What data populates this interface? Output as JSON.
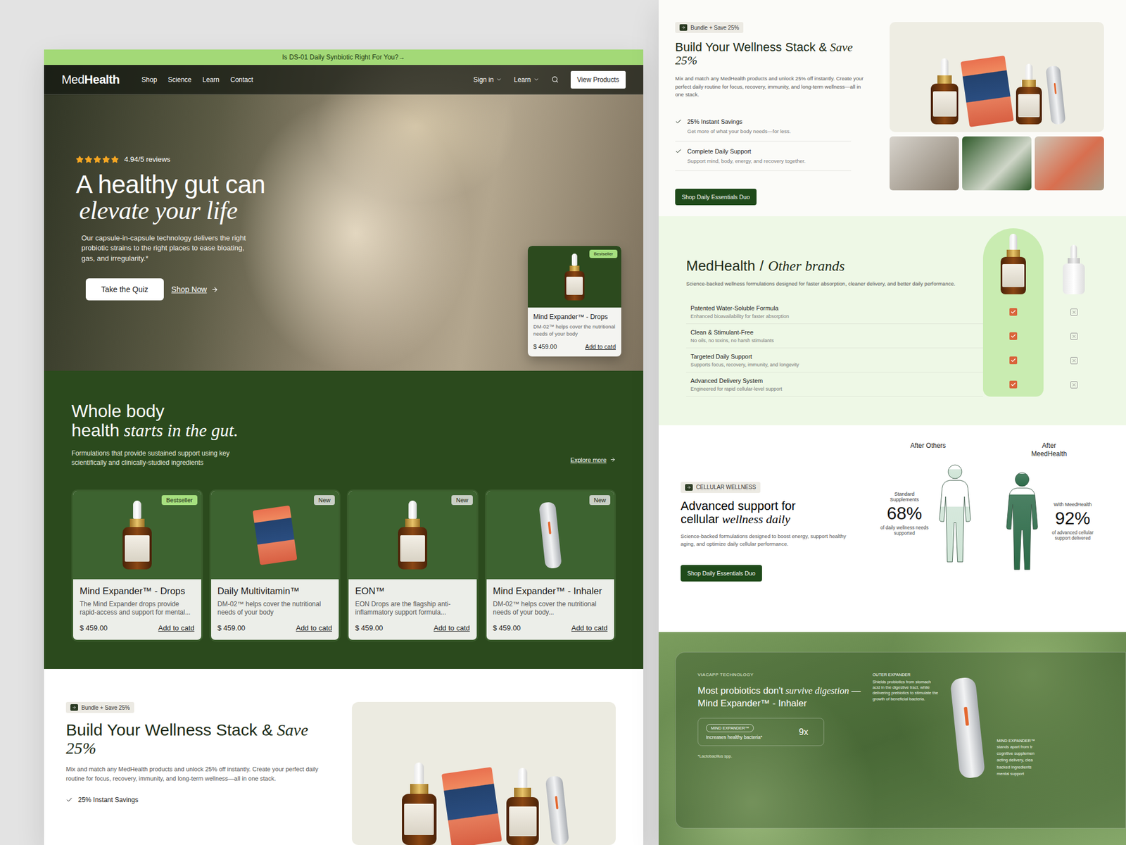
{
  "promo_bar": {
    "text": "Is DS-01 Daily Synbiotic Right For You?→"
  },
  "nav": {
    "logo_light": "Med",
    "logo_bold": "Health",
    "links": [
      "Shop",
      "Science",
      "Learn",
      "Contact"
    ],
    "menus": [
      "Sign in",
      "Learn"
    ],
    "cta": "View Products"
  },
  "hero": {
    "stars": 5,
    "rating": "4.94/5 reviews",
    "title_plain": "A healthy gut can",
    "title_italic": "elevate your life",
    "text": "Our capsule-in-capsule technology delivers the right probiotic strains to the right places to ease bloating, gas, and irregularity.*",
    "primary_button": "Take the Quiz",
    "link": "Shop Now"
  },
  "featured_card": {
    "badge": "Bestseller",
    "title": "Mind Expander™ - Drops",
    "text": "DM-02™ helps cover the nutritional needs of your body",
    "price": "$ 459.00",
    "action": "Add to catd",
    "kind": "dropper"
  },
  "products_section": {
    "title_plain": "Whole body health",
    "title_italic": "starts in the gut.",
    "text": "Formulations that provide sustained support using key scientifically and clinically-studied ingredients",
    "link": "Explore more"
  },
  "products": [
    {
      "badge": "Bestseller",
      "badge_color": "#a6e07f",
      "kind": "dropper",
      "title": "Mind Expander™ - Drops",
      "text": "The Mind Expander drops provide rapid-access and support for mental...",
      "price": "$ 459.00",
      "action": "Add to catd"
    },
    {
      "badge": "New",
      "badge_color": "#c9cfc5",
      "kind": "pouch",
      "title": "Daily Multivitamin™",
      "text": "DM-02™ helps cover the nutritional needs of your body",
      "price": "$ 459.00",
      "action": "Add to catd"
    },
    {
      "badge": "New",
      "badge_color": "#c9cfc5",
      "kind": "dropper",
      "title": "EON™",
      "text": "EON Drops are the flagship anti-inflammatory support formula...",
      "price": "$ 459.00",
      "action": "Add to catd"
    },
    {
      "badge": "New",
      "badge_color": "#c9cfc5",
      "kind": "inhaler",
      "title": "Mind Expander™ - Inhaler",
      "text": "DM-02™ helps cover the nutritional needs of your body...",
      "price": "$ 459.00",
      "action": "Add to catd"
    }
  ],
  "bundle_preview": {
    "badge": "Bundle + Save 25%",
    "title_plain": "Build Your Wellness Stack &",
    "title_italic": "Save 25%",
    "text": "Mix and match any MedHealth  products and unlock 25% off instantly. Create your perfect daily routine for focus, recovery, immunity, and long-term wellness—all in one stack.",
    "features": [
      "25% Instant Savings"
    ]
  },
  "bundle": {
    "badge": "Bundle + Save 25%",
    "title_plain": "Build Your Wellness Stack &",
    "title_italic": "Save 25%",
    "text": "Mix and match any MedHealth  products and unlock 25% off instantly. Create your perfect daily routine for focus, recovery, immunity, and long-term wellness—all in one stack.",
    "features": [
      {
        "title": "25% Instant Savings",
        "text": "Get more of what your body needs—for less."
      },
      {
        "title": "Complete Daily Support",
        "text": "Support mind, body, energy, and recovery together."
      }
    ],
    "button": "Shop Daily Essentials Duo"
  },
  "comparison": {
    "brand": "MedHealth",
    "separator": "/",
    "other": "Other brands",
    "text": "Science-backed wellness formulations designed for faster absorption, cleaner delivery, and better daily performance.",
    "rows": [
      {
        "title": "Patented Water-Soluble Formula",
        "text": "Enhanced bioavailability for faster absorption",
        "ours": true,
        "theirs": false
      },
      {
        "title": "Clean & Stimulant-Free",
        "text": "No oils, no toxins, no harsh stimulants",
        "ours": true,
        "theirs": false
      },
      {
        "title": "Targeted Daily Support",
        "text": "Supports focus, recovery, immunity, and longevity",
        "ours": true,
        "theirs": false
      },
      {
        "title": "Advanced Delivery System",
        "text": "Engineered for rapid cellular-level support",
        "ours": true,
        "theirs": false
      }
    ]
  },
  "cellular": {
    "badge": "CELLULAR WELLNESS",
    "title_plain": "Advanced support for cellular",
    "title_italic": "wellness daily",
    "text": "Science-backed formulations designed to boost energy, support healthy aging, and optimize daily cellular performance.",
    "button": "Shop Daily Essentials Duo",
    "figures": [
      {
        "label": "After Others",
        "side_label": "Standard Supplements",
        "value": "68%",
        "caption": "of daily wellness needs supported",
        "level": 0.68,
        "color": "#cfe4d6"
      },
      {
        "label": "After MeedHealth",
        "side_label": "With MeedHealth",
        "value": "92%",
        "caption": "of advanced cellular support delivered",
        "level": 0.92,
        "color": "#2c6a48"
      }
    ]
  },
  "technology": {
    "badge": "VIACAPP TECHNOLOGY",
    "title": [
      {
        "text": "Most probiotics don't",
        "italic": false
      },
      {
        "text": "survive",
        "italic": true
      },
      {
        "text": "digestion",
        "italic": true
      },
      {
        "text": "—Mind Expander™ - Inhaler",
        "italic": false
      }
    ],
    "pill": "MIND EXPANDER™",
    "pill_text": "Increases healthy bacteria*",
    "multiplier": "9x",
    "footnote": "*Lactobacillus spp.",
    "outer_title": "OUTER EXPANDER",
    "outer_text": "Shields probiotics from stomach acid in the digestive tract, while delivering prebiotics to stimulate the growth of beneficial bacteria.",
    "inner_title": "MIND EXPANDER™",
    "inner_lines": [
      "stands apart from tr",
      "cognitive supplemen",
      "acting delivery, clea",
      "backed ingredients",
      "mental support"
    ]
  }
}
